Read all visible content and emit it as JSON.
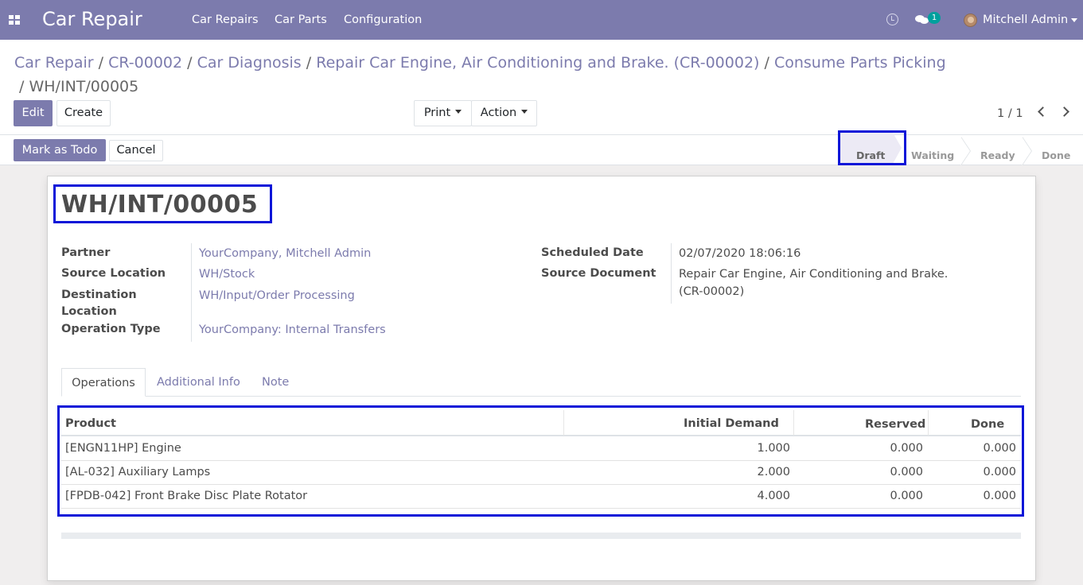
{
  "navbar": {
    "app_title": "Car Repair",
    "menu": [
      "Car Repairs",
      "Car Parts",
      "Configuration"
    ],
    "chat_badge": "1",
    "user_name": "Mitchell Admin",
    "color": "#7c7bad"
  },
  "breadcrumb": {
    "items": [
      "Car Repair",
      "CR-00002",
      "Car Diagnosis",
      "Repair Car Engine, Air Conditioning and Brake. (CR-00002)",
      "Consume Parts Picking"
    ],
    "current": "WH/INT/00005"
  },
  "toolbar": {
    "edit": "Edit",
    "create": "Create",
    "print": "Print",
    "action": "Action",
    "pager": "1 / 1"
  },
  "statusbar": {
    "mark_todo": "Mark as Todo",
    "cancel": "Cancel",
    "stages": [
      "Draft",
      "Waiting",
      "Ready",
      "Done"
    ],
    "active_stage": "Draft"
  },
  "record": {
    "name": "WH/INT/00005",
    "fields_left": [
      {
        "label": "Partner",
        "value": "YourCompany, Mitchell Admin"
      },
      {
        "label": "Source Location",
        "value": "WH/Stock"
      },
      {
        "label": "Destination Location",
        "value": "WH/Input/Order Processing"
      },
      {
        "label": "Operation Type",
        "value": "YourCompany: Internal Transfers"
      }
    ],
    "fields_right": [
      {
        "label": "Scheduled Date",
        "value": "02/07/2020 18:06:16"
      },
      {
        "label": "Source Document",
        "value": "Repair Car Engine, Air Conditioning and Brake. (CR-00002)"
      }
    ]
  },
  "tabs": [
    "Operations",
    "Additional Info",
    "Note"
  ],
  "table": {
    "columns": [
      "Product",
      "Initial Demand",
      "Reserved",
      "Done"
    ],
    "rows": [
      [
        "[ENGN11HP] Engine",
        "1.000",
        "0.000",
        "0.000"
      ],
      [
        "[AL-032] Auxiliary Lamps",
        "2.000",
        "0.000",
        "0.000"
      ],
      [
        "[FPDB-042] Front Brake Disc Plate Rotator",
        "4.000",
        "0.000",
        "0.000"
      ]
    ]
  }
}
